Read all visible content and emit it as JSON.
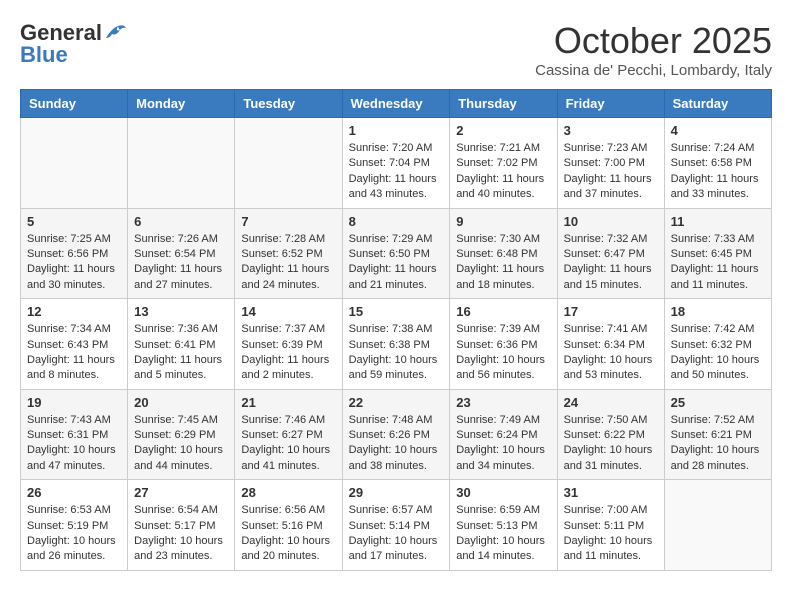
{
  "header": {
    "logo_general": "General",
    "logo_blue": "Blue",
    "month_title": "October 2025",
    "location": "Cassina de' Pecchi, Lombardy, Italy"
  },
  "days_of_week": [
    "Sunday",
    "Monday",
    "Tuesday",
    "Wednesday",
    "Thursday",
    "Friday",
    "Saturday"
  ],
  "weeks": [
    [
      {
        "day": "",
        "info": ""
      },
      {
        "day": "",
        "info": ""
      },
      {
        "day": "",
        "info": ""
      },
      {
        "day": "1",
        "info": "Sunrise: 7:20 AM\nSunset: 7:04 PM\nDaylight: 11 hours and 43 minutes."
      },
      {
        "day": "2",
        "info": "Sunrise: 7:21 AM\nSunset: 7:02 PM\nDaylight: 11 hours and 40 minutes."
      },
      {
        "day": "3",
        "info": "Sunrise: 7:23 AM\nSunset: 7:00 PM\nDaylight: 11 hours and 37 minutes."
      },
      {
        "day": "4",
        "info": "Sunrise: 7:24 AM\nSunset: 6:58 PM\nDaylight: 11 hours and 33 minutes."
      }
    ],
    [
      {
        "day": "5",
        "info": "Sunrise: 7:25 AM\nSunset: 6:56 PM\nDaylight: 11 hours and 30 minutes."
      },
      {
        "day": "6",
        "info": "Sunrise: 7:26 AM\nSunset: 6:54 PM\nDaylight: 11 hours and 27 minutes."
      },
      {
        "day": "7",
        "info": "Sunrise: 7:28 AM\nSunset: 6:52 PM\nDaylight: 11 hours and 24 minutes."
      },
      {
        "day": "8",
        "info": "Sunrise: 7:29 AM\nSunset: 6:50 PM\nDaylight: 11 hours and 21 minutes."
      },
      {
        "day": "9",
        "info": "Sunrise: 7:30 AM\nSunset: 6:48 PM\nDaylight: 11 hours and 18 minutes."
      },
      {
        "day": "10",
        "info": "Sunrise: 7:32 AM\nSunset: 6:47 PM\nDaylight: 11 hours and 15 minutes."
      },
      {
        "day": "11",
        "info": "Sunrise: 7:33 AM\nSunset: 6:45 PM\nDaylight: 11 hours and 11 minutes."
      }
    ],
    [
      {
        "day": "12",
        "info": "Sunrise: 7:34 AM\nSunset: 6:43 PM\nDaylight: 11 hours and 8 minutes."
      },
      {
        "day": "13",
        "info": "Sunrise: 7:36 AM\nSunset: 6:41 PM\nDaylight: 11 hours and 5 minutes."
      },
      {
        "day": "14",
        "info": "Sunrise: 7:37 AM\nSunset: 6:39 PM\nDaylight: 11 hours and 2 minutes."
      },
      {
        "day": "15",
        "info": "Sunrise: 7:38 AM\nSunset: 6:38 PM\nDaylight: 10 hours and 59 minutes."
      },
      {
        "day": "16",
        "info": "Sunrise: 7:39 AM\nSunset: 6:36 PM\nDaylight: 10 hours and 56 minutes."
      },
      {
        "day": "17",
        "info": "Sunrise: 7:41 AM\nSunset: 6:34 PM\nDaylight: 10 hours and 53 minutes."
      },
      {
        "day": "18",
        "info": "Sunrise: 7:42 AM\nSunset: 6:32 PM\nDaylight: 10 hours and 50 minutes."
      }
    ],
    [
      {
        "day": "19",
        "info": "Sunrise: 7:43 AM\nSunset: 6:31 PM\nDaylight: 10 hours and 47 minutes."
      },
      {
        "day": "20",
        "info": "Sunrise: 7:45 AM\nSunset: 6:29 PM\nDaylight: 10 hours and 44 minutes."
      },
      {
        "day": "21",
        "info": "Sunrise: 7:46 AM\nSunset: 6:27 PM\nDaylight: 10 hours and 41 minutes."
      },
      {
        "day": "22",
        "info": "Sunrise: 7:48 AM\nSunset: 6:26 PM\nDaylight: 10 hours and 38 minutes."
      },
      {
        "day": "23",
        "info": "Sunrise: 7:49 AM\nSunset: 6:24 PM\nDaylight: 10 hours and 34 minutes."
      },
      {
        "day": "24",
        "info": "Sunrise: 7:50 AM\nSunset: 6:22 PM\nDaylight: 10 hours and 31 minutes."
      },
      {
        "day": "25",
        "info": "Sunrise: 7:52 AM\nSunset: 6:21 PM\nDaylight: 10 hours and 28 minutes."
      }
    ],
    [
      {
        "day": "26",
        "info": "Sunrise: 6:53 AM\nSunset: 5:19 PM\nDaylight: 10 hours and 26 minutes."
      },
      {
        "day": "27",
        "info": "Sunrise: 6:54 AM\nSunset: 5:17 PM\nDaylight: 10 hours and 23 minutes."
      },
      {
        "day": "28",
        "info": "Sunrise: 6:56 AM\nSunset: 5:16 PM\nDaylight: 10 hours and 20 minutes."
      },
      {
        "day": "29",
        "info": "Sunrise: 6:57 AM\nSunset: 5:14 PM\nDaylight: 10 hours and 17 minutes."
      },
      {
        "day": "30",
        "info": "Sunrise: 6:59 AM\nSunset: 5:13 PM\nDaylight: 10 hours and 14 minutes."
      },
      {
        "day": "31",
        "info": "Sunrise: 7:00 AM\nSunset: 5:11 PM\nDaylight: 10 hours and 11 minutes."
      },
      {
        "day": "",
        "info": ""
      }
    ]
  ]
}
